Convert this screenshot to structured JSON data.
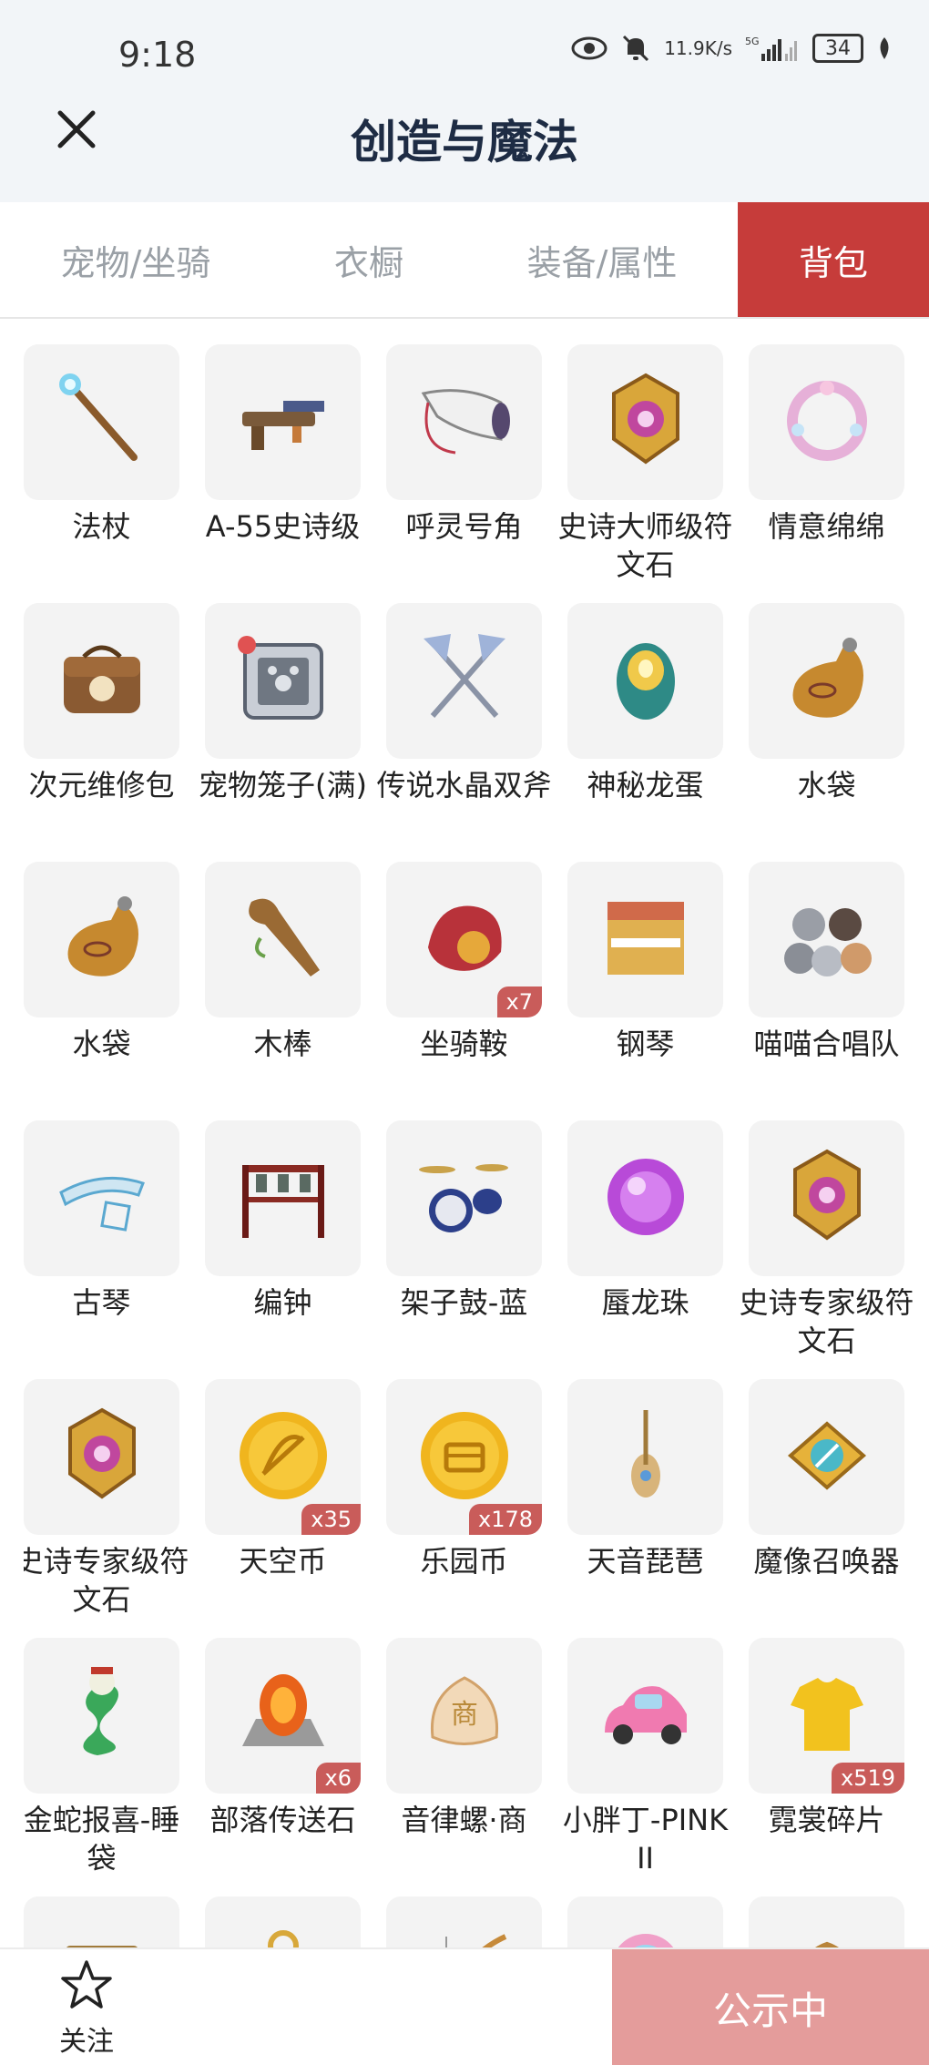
{
  "status_bar": {
    "time": "9:18",
    "network_speed_value": "11.9",
    "network_speed_unit": "K/s",
    "network_type": "5G",
    "battery": "34"
  },
  "header": {
    "title": "创造与魔法"
  },
  "tabs": [
    {
      "label": "宠物/坐骑",
      "active": false
    },
    {
      "label": "衣橱",
      "active": false
    },
    {
      "label": "装备/属性",
      "active": false
    },
    {
      "label": "背包",
      "active": true
    }
  ],
  "items": [
    {
      "name": "法杖",
      "icon": "staff-icon",
      "qty": ""
    },
    {
      "name": "A-55史诗级",
      "icon": "gun-icon",
      "qty": ""
    },
    {
      "name": "呼灵号角",
      "icon": "horn-icon",
      "qty": ""
    },
    {
      "name": "史诗大师级符文石",
      "icon": "rune-stone-icon",
      "qty": ""
    },
    {
      "name": "情意绵绵",
      "icon": "wreath-icon",
      "qty": ""
    },
    {
      "name": "次元维修包",
      "icon": "repair-bag-icon",
      "qty": ""
    },
    {
      "name": "宠物笼子(满)",
      "icon": "pet-cage-icon",
      "qty": ""
    },
    {
      "name": "传说水晶双斧",
      "icon": "double-axe-icon",
      "qty": ""
    },
    {
      "name": "神秘龙蛋",
      "icon": "dragon-egg-icon",
      "qty": ""
    },
    {
      "name": "水袋",
      "icon": "water-bag-icon",
      "qty": ""
    },
    {
      "name": "水袋",
      "icon": "water-bag-icon",
      "qty": ""
    },
    {
      "name": "木棒",
      "icon": "wooden-club-icon",
      "qty": ""
    },
    {
      "name": "坐骑鞍",
      "icon": "saddle-icon",
      "qty": "x7"
    },
    {
      "name": "钢琴",
      "icon": "piano-icon",
      "qty": ""
    },
    {
      "name": "喵喵合唱队",
      "icon": "cat-choir-icon",
      "qty": ""
    },
    {
      "name": "古琴",
      "icon": "guqin-icon",
      "qty": ""
    },
    {
      "name": "编钟",
      "icon": "bells-icon",
      "qty": ""
    },
    {
      "name": "架子鼓-蓝",
      "icon": "drum-kit-icon",
      "qty": ""
    },
    {
      "name": "蜃龙珠",
      "icon": "dragon-pearl-icon",
      "qty": ""
    },
    {
      "name": "史诗专家级符文石",
      "icon": "rune-stone-icon",
      "qty": ""
    },
    {
      "name": "史诗专家级符文石",
      "icon": "rune-stone-icon",
      "qty": ""
    },
    {
      "name": "天空币",
      "icon": "sky-coin-icon",
      "qty": "x35"
    },
    {
      "name": "乐园币",
      "icon": "park-coin-icon",
      "qty": "x178"
    },
    {
      "name": "天音琵琶",
      "icon": "pipa-icon",
      "qty": ""
    },
    {
      "name": "魔像召唤器",
      "icon": "golem-summoner-icon",
      "qty": ""
    },
    {
      "name": "金蛇报喜-睡袋",
      "icon": "snake-sleeping-bag-icon",
      "qty": ""
    },
    {
      "name": "部落传送石",
      "icon": "teleport-stone-icon",
      "qty": "x6"
    },
    {
      "name": "音律螺·商",
      "icon": "conch-icon",
      "qty": ""
    },
    {
      "name": "小胖丁-PINK II",
      "icon": "pink-car-icon",
      "qty": ""
    },
    {
      "name": "霓裳碎片",
      "icon": "shirt-fragment-icon",
      "qty": "x519"
    },
    {
      "name": "",
      "icon": "scroll-icon",
      "qty": ""
    },
    {
      "name": "",
      "icon": "key-icon",
      "qty": ""
    },
    {
      "name": "",
      "icon": "fishing-rod-icon",
      "qty": ""
    },
    {
      "name": "",
      "icon": "lollipop-icon",
      "qty": ""
    },
    {
      "name": "",
      "icon": "antler-icon",
      "qty": ""
    }
  ],
  "bottom_bar": {
    "follow_label": "关注",
    "notice_label": "公示中"
  },
  "colors": {
    "active_tab": "#c63c3a",
    "notice_button": "#e49c9b",
    "qty_badge": "#c95c5a",
    "title": "#1e2c44"
  }
}
